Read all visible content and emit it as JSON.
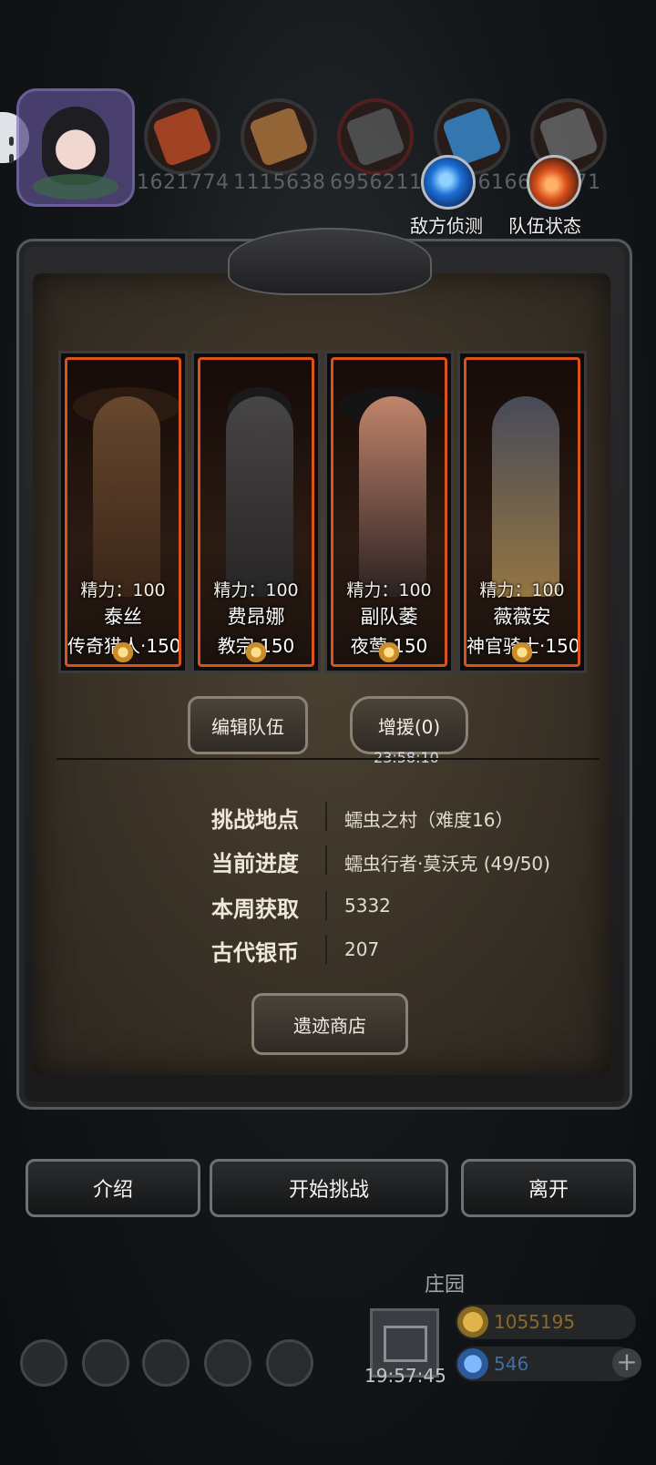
{
  "resources": [
    {
      "value": "1621774",
      "color": "#c0502a"
    },
    {
      "value": "1115638",
      "color": "#b07a3a"
    },
    {
      "value": "6956211",
      "color": "#666666"
    },
    {
      "value": "16166",
      "color": "#3f8fd0"
    },
    {
      "value": "371",
      "color": "#777777"
    }
  ],
  "actions": {
    "scout_label": "敌方侦测",
    "status_label": "队伍状态"
  },
  "team": [
    {
      "energy": "精力：100",
      "name": "泰丝",
      "role": "传奇猎人·150",
      "tone": "#7a5234"
    },
    {
      "energy": "精力：100",
      "name": "费昂娜",
      "role": "教宗·150",
      "tone": "#3b3a3c"
    },
    {
      "energy": "精力：100",
      "name": "副队萎",
      "role": "夜莺·150",
      "tone": "#2c2422"
    },
    {
      "energy": "精力：100",
      "name": "薇薇安",
      "role": "神官骑士·150",
      "tone": "#2f3340"
    }
  ],
  "team_controls": {
    "edit_label": "编辑队伍",
    "reinforce_label": "增援(0)",
    "reinforce_timer": "23:58:10"
  },
  "info": {
    "location_label": "挑战地点",
    "location_value": "蠕虫之村（难度16）",
    "progress_label": "当前进度",
    "progress_value": "蠕虫行者·莫沃克 (49/50)",
    "weekly_label": "本周获取",
    "weekly_value": "5332",
    "coin_label": "古代银币",
    "coin_value": "207"
  },
  "shop_label": "遗迹商店",
  "buttons": {
    "intro": "介绍",
    "start": "开始挑战",
    "leave": "离开"
  },
  "bottom": {
    "manor_label": "庄园",
    "gift_timer": "19:57:45",
    "gold_value": "1055195",
    "gem_value": "546",
    "plus_label": "+"
  }
}
